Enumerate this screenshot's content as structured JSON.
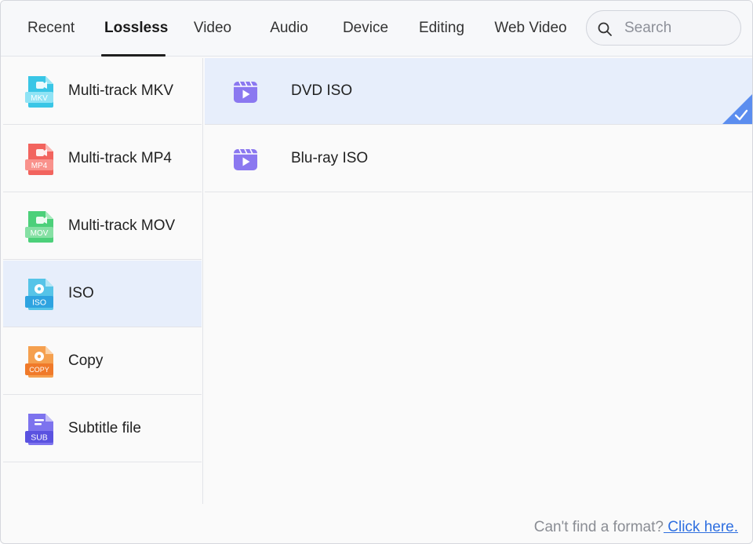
{
  "tabs": [
    {
      "label": "Recent"
    },
    {
      "label": "Lossless",
      "active": true
    },
    {
      "label": "Video"
    },
    {
      "label": "Audio"
    },
    {
      "label": "Device"
    },
    {
      "label": "Editing"
    },
    {
      "label": "Web Video"
    }
  ],
  "search": {
    "placeholder": "Search",
    "value": ""
  },
  "categories": [
    {
      "label": "Multi-track MKV",
      "icon": "mkv-file-icon",
      "badge": "MKV",
      "color": "#39c6e6"
    },
    {
      "label": "Multi-track MP4",
      "icon": "mp4-file-icon",
      "badge": "MP4",
      "color": "#f2645e"
    },
    {
      "label": "Multi-track MOV",
      "icon": "mov-file-icon",
      "badge": "MOV",
      "color": "#4cd07a"
    },
    {
      "label": "ISO",
      "icon": "iso-disc-icon",
      "badge": "ISO",
      "color": "#2ea3e0",
      "selected": true
    },
    {
      "label": "Copy",
      "icon": "copy-disc-icon",
      "badge": "COPY",
      "color": "#f07a2a"
    },
    {
      "label": "Subtitle file",
      "icon": "subtitle-file-icon",
      "badge": "SUB",
      "color": "#6a63e6"
    }
  ],
  "formats": [
    {
      "label": "DVD ISO",
      "icon": "video-play-icon",
      "selected": true
    },
    {
      "label": "Blu-ray ISO",
      "icon": "video-play-icon"
    }
  ],
  "footer": {
    "prompt": "Can't find a format?",
    "link": " Click here."
  },
  "colors": {
    "accent": "#5b8def",
    "selected_bg": "#e7eefb",
    "video_icon": "#8b78f0"
  }
}
